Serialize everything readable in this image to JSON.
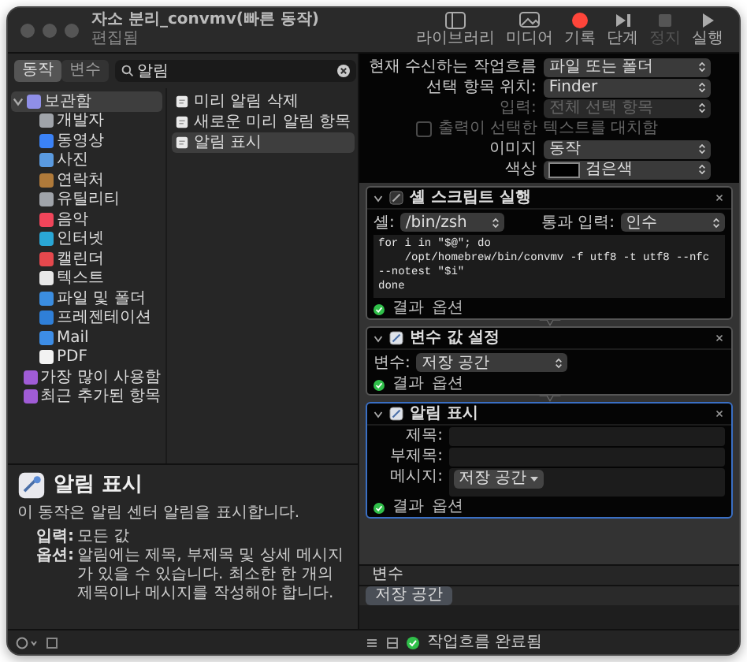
{
  "window": {
    "title": "자소 분리_convmv(빠른 동작)",
    "subtitle": "편집됨"
  },
  "toolbar": [
    {
      "kind": "library",
      "label": "라이브러리",
      "disabled": false
    },
    {
      "kind": "media",
      "label": "미디어",
      "disabled": false
    },
    {
      "kind": "record",
      "label": "기록",
      "disabled": false
    },
    {
      "kind": "step",
      "label": "단계",
      "disabled": false
    },
    {
      "kind": "stop",
      "label": "정지",
      "disabled": true
    },
    {
      "kind": "run",
      "label": "실행",
      "disabled": false
    }
  ],
  "library": {
    "tabs": [
      {
        "label": "동작",
        "selected": true
      },
      {
        "label": "변수",
        "selected": false
      }
    ],
    "search": {
      "value": "알림"
    },
    "categories": [
      {
        "label": "보관함",
        "color": "#8f8fe8",
        "expanded": true,
        "selected": true,
        "children": [
          {
            "label": "개발자",
            "color": "#a0a4aa",
            "selected": false
          },
          {
            "label": "동영상",
            "color": "#3b82f6",
            "selected": false
          },
          {
            "label": "사진",
            "color": "#5a9ae0",
            "selected": false
          },
          {
            "label": "연락처",
            "color": "#b07a3a",
            "selected": false
          },
          {
            "label": "유틸리티",
            "color": "#a0a4aa",
            "selected": false
          },
          {
            "label": "음악",
            "color": "#f0455a",
            "selected": false
          },
          {
            "label": "인터넷",
            "color": "#2aa7d6",
            "selected": false
          },
          {
            "label": "캘린더",
            "color": "#e5484d",
            "selected": false
          },
          {
            "label": "텍스트",
            "color": "#e8e8e8",
            "selected": false
          },
          {
            "label": "파일 및 폴더",
            "color": "#3b8de0",
            "selected": false
          },
          {
            "label": "프레젠테이션",
            "color": "#2f7fd8",
            "selected": false
          },
          {
            "label": "Mail",
            "color": "#3d8de6",
            "selected": false
          },
          {
            "label": "PDF",
            "color": "#f2f2f2",
            "selected": false
          }
        ]
      },
      {
        "label": "가장 많이 사용함",
        "color": "#a05cd6",
        "selected": false
      },
      {
        "label": "최근 추가된 항목",
        "color": "#a05cd6",
        "selected": false
      }
    ],
    "actions": [
      {
        "label": "미리 알림 삭제",
        "selected": false
      },
      {
        "label": "새로운 미리 알림 항목",
        "selected": false
      },
      {
        "label": "알림 표시",
        "selected": true
      }
    ]
  },
  "description": {
    "title": "알림 표시",
    "summary": "이 동작은 알림 센터 알림을 표시합니다.",
    "details": [
      {
        "label": "입력:",
        "value": "모든 값"
      },
      {
        "label": "옵션:",
        "value": "알림에는 제목, 부제목 및 상세 메시지가 있을 수 있습니다. 최소한 한 개의 제목이나 메시지를 작성해야 합니다."
      }
    ]
  },
  "settings": [
    {
      "kind": "popup",
      "label": "현재 수신하는 작업흐름",
      "value": "파일 또는 폴더",
      "disabled": false
    },
    {
      "kind": "popup",
      "label": "선택 항목 위치:",
      "value": "Finder",
      "disabled": false
    },
    {
      "kind": "popup",
      "label": "입력:",
      "value": "전체 선택 항목",
      "disabled": true
    },
    {
      "kind": "checkbox",
      "label": "출력이 선택한 텍스트를 대치함",
      "checked": false,
      "disabled": true
    },
    {
      "kind": "popup",
      "label": "이미지",
      "value": "동작",
      "disabled": false
    },
    {
      "kind": "swatch",
      "label": "색상",
      "value": "검은색",
      "disabled": false
    }
  ],
  "steps": [
    {
      "kind": "shell",
      "title": "셸 스크립트 실행",
      "expanded": true,
      "selected": false,
      "shell_label": "셸:",
      "shell": "/bin/zsh",
      "pass_label": "통과 입력:",
      "pass": "인수",
      "code": [
        "for i in \"$@\"; do",
        "    /opt/homebrew/bin/convmv -f utf8 -t utf8 --nfc --notest \"$i\"",
        "done"
      ],
      "results": "결과",
      "options": "옵션"
    },
    {
      "kind": "variable",
      "title": "변수 값 설정",
      "expanded": true,
      "selected": false,
      "var_label": "변수:",
      "var": "저장 공간",
      "results": "결과",
      "options": "옵션"
    },
    {
      "kind": "notification",
      "title": "알림 표시",
      "expanded": true,
      "selected": true,
      "fields": [
        {
          "label": "제목:"
        },
        {
          "label": "부제목:"
        },
        {
          "label": "메시지:",
          "token": "저장 공간"
        }
      ],
      "results": "결과",
      "options": "옵션"
    }
  ],
  "variables": {
    "title": "변수",
    "items": [
      {
        "label": "저장 공간"
      }
    ]
  },
  "status": {
    "text": "작업흐름 완료됨"
  }
}
